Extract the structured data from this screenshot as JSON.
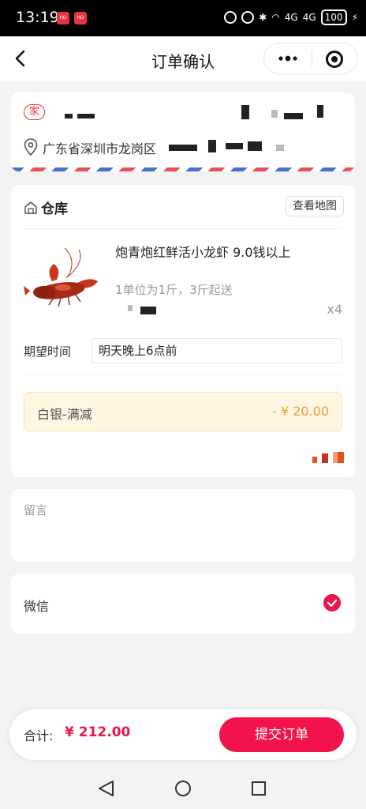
{
  "status_bar": {
    "time": "13:19",
    "battery": "100",
    "network1": "4G",
    "network2": "4G",
    "hd1": "HD",
    "hd2": "HD"
  },
  "nav": {
    "title": "订单确认"
  },
  "address": {
    "tag": "家",
    "text": "广东省深圳市龙岗区"
  },
  "warehouse": {
    "title": "仓库",
    "map_button": "查看地图"
  },
  "product": {
    "name": "炮青炮红鲜活小龙虾 9.0钱以上",
    "unit_desc": "1单位为1斤，3斤起送",
    "quantity": "x4"
  },
  "delivery": {
    "label": "期望时间",
    "value": "明天晚上6点前"
  },
  "coupon": {
    "name": "白银-满减",
    "amount": "- ¥ 20.00"
  },
  "message": {
    "placeholder": "留言"
  },
  "payment": {
    "method": "微信"
  },
  "footer": {
    "total_label": "合计:",
    "total_value": "¥ 212.00",
    "submit_label": "提交订单"
  },
  "colors": {
    "accent": "#f2134a",
    "coupon_bg": "#fef6e0",
    "coupon_text": "#e8a03a"
  }
}
